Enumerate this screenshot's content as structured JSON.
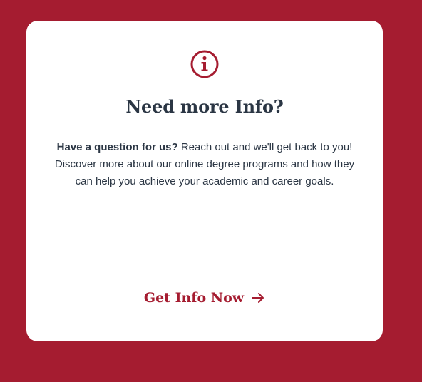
{
  "card": {
    "icon": "info-circle-icon",
    "title": "Need more Info?",
    "description_lead": "Have a question for us?",
    "description_rest": " Reach out and we'll get back to you! Discover more about our online degree programs and how they can help you achieve your academic and career goals.",
    "cta_label": "Get Info Now",
    "cta_icon": "arrow-right-icon"
  },
  "colors": {
    "background": "#a51c30",
    "card": "#ffffff",
    "accent": "#a51c30",
    "text": "#2b3644"
  }
}
